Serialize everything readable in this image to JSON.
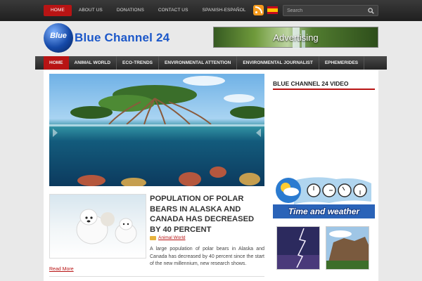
{
  "topnav": {
    "items": [
      {
        "label": "HOME",
        "active": true
      },
      {
        "label": "ABOUT US",
        "active": false
      },
      {
        "label": "DONATIONS",
        "active": false
      },
      {
        "label": "CONTACT US",
        "active": false
      },
      {
        "label": "SPANISH-ESPAÑOL",
        "active": false
      }
    ]
  },
  "icons": {
    "rss": "rss-icon",
    "flag": "spain-flag-icon",
    "search": "magnifier-icon"
  },
  "search": {
    "placeholder": "Search",
    "value": ""
  },
  "logo": {
    "globe_text": "Blue",
    "text": "Blue Channel 24"
  },
  "ad": {
    "text": "Advertising"
  },
  "mainnav": {
    "items": [
      {
        "label": "HOME",
        "active": true
      },
      {
        "label": "ANIMAL WORLD",
        "active": false
      },
      {
        "label": "ECO-TRENDS",
        "active": false
      },
      {
        "label": "ENVIRONMENTAL ATTENTION",
        "active": false
      },
      {
        "label": "ENVIRONMENTAL JOURNALIST",
        "active": false
      },
      {
        "label": "EPHEMERIDES",
        "active": false
      }
    ]
  },
  "article": {
    "title": "Population of polar bears in Alaska and Canada has decreased by 40 percent",
    "category": "Animal World",
    "excerpt": "A large population of polar bears in Alaska and Canada has decreased by 40 percent since the start of the new millennium, new research shows.",
    "read_more": "Read More"
  },
  "sidebar": {
    "video_heading": "Blue Channel 24 Video",
    "weather_title": "Time and weather"
  },
  "colors": {
    "accent": "#b81414",
    "brand_blue": "#1b57c9",
    "topbar": "#262626"
  }
}
